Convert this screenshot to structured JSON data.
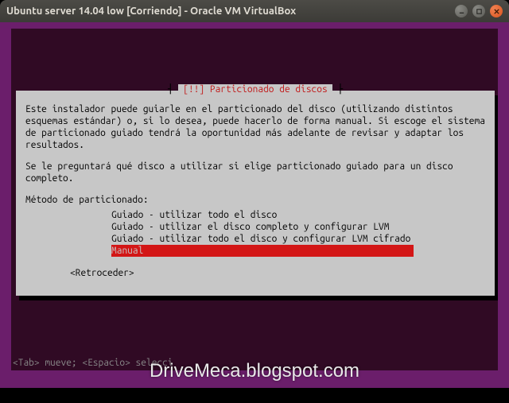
{
  "window": {
    "title": "Ubuntu server 14.04 low [Corriendo] - Oracle VM VirtualBox"
  },
  "dialog": {
    "title": "[!!] Particionado de discos",
    "paragraph1": "Este instalador puede guiarle en el particionado del disco (utilizando distintos esquemas estándar) o, si lo desea, puede hacerlo de forma manual. Si escoge el sistema de particionado guiado tendrá la oportunidad más adelante de revisar y adaptar los resultados.",
    "paragraph2": "Se le preguntará qué disco a utilizar si elige particionado guiado para un disco completo.",
    "prompt": "Método de particionado:",
    "options": [
      "Guiado - utilizar todo el disco",
      "Guiado - utilizar el disco completo y configurar LVM",
      "Guiado - utilizar todo el disco y configurar LVM cifrado",
      "Manual"
    ],
    "selected_index": 3,
    "back": "<Retroceder>"
  },
  "statusbar": "<Tab> mueve; <Espacio> selecci",
  "watermark": "DriveMeca.blogspot.com"
}
